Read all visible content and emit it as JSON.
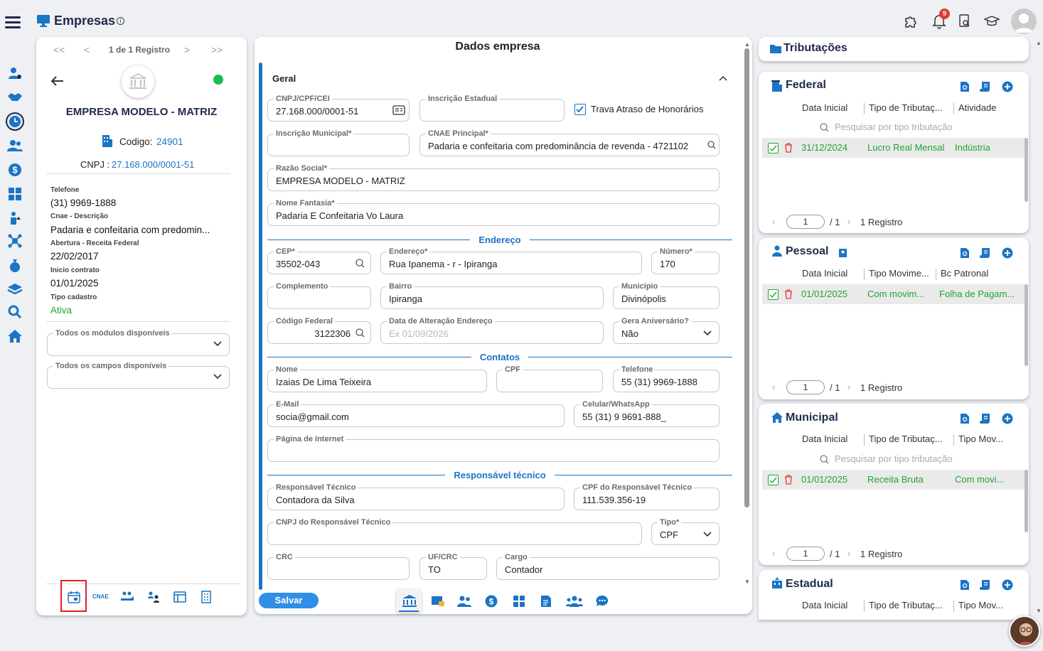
{
  "header": {
    "title": "Empresas",
    "notif_count": "9"
  },
  "left": {
    "pager": {
      "first": "<<",
      "prev": "<",
      "text": "1 de 1 Registro",
      "next": ">",
      "last": ">>"
    },
    "company_name": "EMPRESA MODELO - MATRIZ",
    "codigo_label": "Codigo:",
    "codigo_value": "24901",
    "cnpj_label": "CNPJ :",
    "cnpj_value": "27.168.000/0001-51",
    "info": [
      {
        "label": "Telefone",
        "value": "(31) 9969-1888"
      },
      {
        "label": "Cnae - Descrição",
        "value": "Padaria e confeitaria com predomin..."
      },
      {
        "label": "Abertura - Receita Federal",
        "value": "22/02/2017"
      },
      {
        "label": "Inicio contrato",
        "value": "01/01/2025"
      },
      {
        "label": "Tipo cadastro",
        "value": "Ativa"
      }
    ],
    "select1": "Todos os módulos disponíveis",
    "select2": "Todos os campos disponíveis",
    "bottom_cnae": "CNAE",
    "status_color": "#1db954"
  },
  "form": {
    "title": "Dados empresa",
    "section_general": "Geral",
    "fields": {
      "cnpj": {
        "label": "CNPJ/CPF/CEI",
        "value": "27.168.000/0001-51"
      },
      "ie": {
        "label": "Inscrição Estadual",
        "value": ""
      },
      "trava": "Trava Atraso de Honorários",
      "im": {
        "label": "Inscrição Municipal*",
        "value": ""
      },
      "cnae": {
        "label": "CNAE Principal*",
        "value": "Padaria e confeitaria com predominância de revenda - 4721102"
      },
      "razao": {
        "label": "Razão Social*",
        "value": "EMPRESA MODELO - MATRIZ"
      },
      "fantasia": {
        "label": "Nome Fantasia*",
        "value": "Padaria E Confeitaria Vo Laura"
      },
      "cep": {
        "label": "CEP*",
        "value": "35502-043"
      },
      "endereco": {
        "label": "Endereço*",
        "value": "Rua Ipanema - r - Ipiranga"
      },
      "numero": {
        "label": "Número*",
        "value": "170"
      },
      "complemento": {
        "label": "Complemento",
        "value": ""
      },
      "bairro": {
        "label": "Bairro",
        "value": "Ipiranga"
      },
      "municipio": {
        "label": "Municipio",
        "value": "Divinópolis"
      },
      "codfed": {
        "label": "Código Federal",
        "value": "3122306"
      },
      "dataalt": {
        "label": "Data de Alteração Endereço",
        "placeholder": "Ex 01/09/2026"
      },
      "aniversario": {
        "label": "Gera Aniversário?",
        "value": "Não"
      },
      "nome": {
        "label": "Nome",
        "value": "Izaias De Lima Teixeira"
      },
      "cpf": {
        "label": "CPF",
        "value": ""
      },
      "telefone": {
        "label": "Telefone",
        "value": "55 (31) 9969-1888"
      },
      "email": {
        "label": "E-Mail",
        "value": "socia@gmail.com"
      },
      "celular": {
        "label": "Celular/WhatsApp",
        "value": "55 (31) 9 9691-888_"
      },
      "pagina": {
        "label": "Página de Internet",
        "value": ""
      },
      "resp": {
        "label": "Responsável Técnico",
        "value": "Contadora da Silva"
      },
      "cpfresp": {
        "label": "CPF do Responsável Técnico",
        "value": "111.539.356-19"
      },
      "cnpjresp": {
        "label": "CNPJ do Responsável Técnico",
        "value": ""
      },
      "tipo": {
        "label": "Tipo*",
        "value": "CPF"
      },
      "crc": {
        "label": "CRC",
        "value": ""
      },
      "ufcrc": {
        "label": "UF/CRC",
        "value": "TO"
      },
      "cargo": {
        "label": "Cargo",
        "value": "Contador"
      }
    },
    "sections": {
      "endereco": "Endereço",
      "contatos": "Contatos",
      "resp": "Responsável técnico"
    },
    "save": "Salvar"
  },
  "tributacoes": {
    "title": "Tributações",
    "federal": {
      "title": "Federal",
      "cols": [
        "Data Inicial",
        "Tipo de Tributaç...",
        "Atividade"
      ],
      "search": "Pesquisar por tipo tributação",
      "row": [
        "31/12/2024",
        "Lucro Real Mensal",
        "Indústria"
      ],
      "page": "1",
      "total": "/ 1",
      "count": "1 Registro"
    },
    "pessoal": {
      "title": "Pessoal",
      "cols": [
        "Data Inicial",
        "Tipo Movime...",
        "Bc Patronal"
      ],
      "row": [
        "01/01/2025",
        "Com movim...",
        "Folha de Pagam..."
      ],
      "page": "1",
      "total": "/ 1",
      "count": "1 Registro"
    },
    "municipal": {
      "title": "Municipal",
      "cols": [
        "Data Inicial",
        "Tipo de Tributaç...",
        "Tipo Mov..."
      ],
      "search": "Pesquisar por tipo tributação",
      "row": [
        "01/01/2025",
        "Receita Bruta",
        "Com movi..."
      ],
      "page": "1",
      "total": "/ 1",
      "count": "1 Registro"
    },
    "estadual": {
      "title": "Estadual",
      "cols": [
        "Data Inicial",
        "Tipo de Tributaç...",
        "Tipo Mov..."
      ]
    }
  }
}
